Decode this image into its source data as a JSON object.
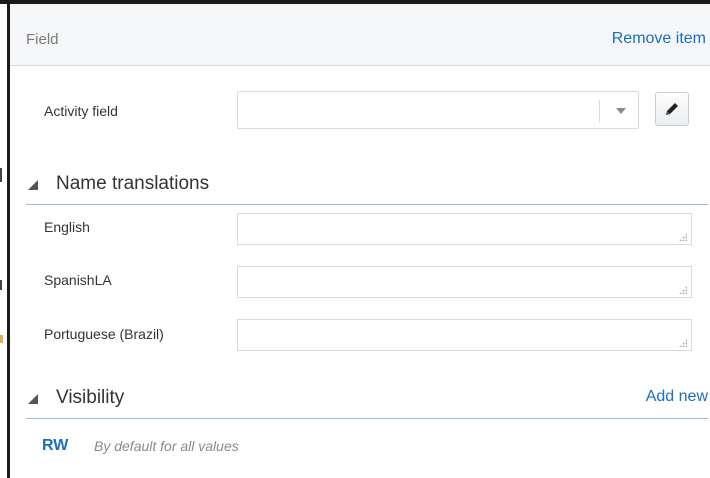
{
  "header": {
    "title": "Field",
    "remove_label": "Remove item"
  },
  "activity": {
    "label": "Activity field",
    "value": ""
  },
  "translations": {
    "title": "Name translations",
    "rows": [
      {
        "label": "English",
        "value": ""
      },
      {
        "label": "SpanishLA",
        "value": ""
      },
      {
        "label": "Portuguese (Brazil)",
        "value": ""
      }
    ]
  },
  "visibility": {
    "title": "Visibility",
    "add_label": "Add new",
    "entry_code": "RW",
    "entry_desc": "By default for all values"
  },
  "icons": {
    "edit": "pencil-icon",
    "dropdown": "chevron-down-icon",
    "collapse": "triangle-collapse-icon",
    "resize": "resize-grip-icon"
  },
  "colors": {
    "link": "#1a6fc0",
    "section_rule": "#9bbbe8",
    "header_bg": "#f5f6f8"
  }
}
